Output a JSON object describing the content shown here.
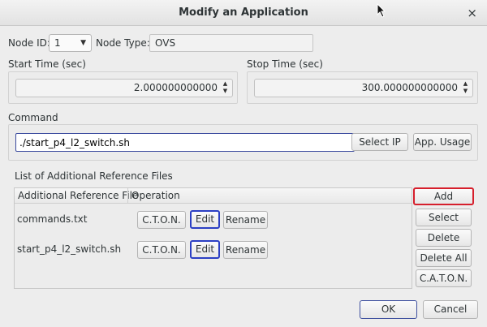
{
  "window": {
    "title": "Modify an Application",
    "close_glyph": "×"
  },
  "node": {
    "id_label": "Node ID:",
    "id_value": "1",
    "type_label": "Node Type:",
    "type_value": "OVS"
  },
  "start_time": {
    "label": "Start Time (sec)",
    "value": "2.000000000000"
  },
  "stop_time": {
    "label": "Stop Time (sec)",
    "value": "300.000000000000"
  },
  "command": {
    "label": "Command",
    "value": "./start_p4_l2_switch.sh",
    "select_ip_label": "Select IP",
    "app_usage_label": "App. Usage"
  },
  "ref_files": {
    "label": "List of Additional Reference Files",
    "columns": [
      "Additional Reference File",
      "Operation"
    ],
    "rows": [
      {
        "file": "commands.txt",
        "cton": "C.T.O.N.",
        "edit": "Edit",
        "rename": "Rename"
      },
      {
        "file": "start_p4_l2_switch.sh",
        "cton": "C.T.O.N.",
        "edit": "Edit",
        "rename": "Rename"
      }
    ]
  },
  "side_buttons": {
    "add": "Add",
    "select": "Select",
    "delete": "Delete",
    "delete_all": "Delete All",
    "caton": "C.A.T.O.N."
  },
  "footer": {
    "ok": "OK",
    "cancel": "Cancel"
  }
}
